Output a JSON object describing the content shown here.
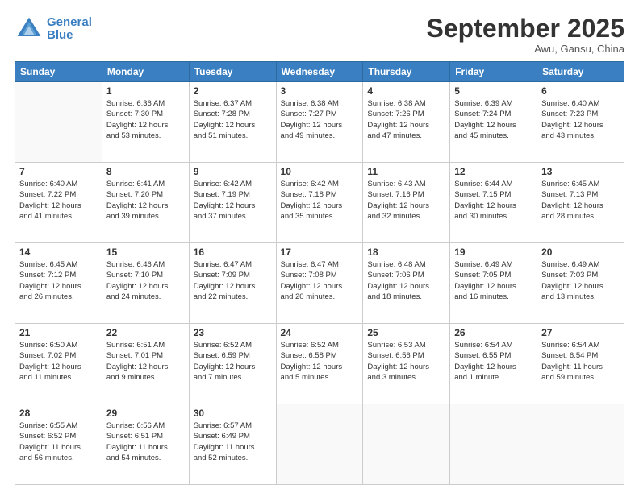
{
  "logo": {
    "line1": "General",
    "line2": "Blue"
  },
  "title": "September 2025",
  "location": "Awu, Gansu, China",
  "days_header": [
    "Sunday",
    "Monday",
    "Tuesday",
    "Wednesday",
    "Thursday",
    "Friday",
    "Saturday"
  ],
  "weeks": [
    [
      {
        "day": "",
        "info": ""
      },
      {
        "day": "1",
        "info": "Sunrise: 6:36 AM\nSunset: 7:30 PM\nDaylight: 12 hours\nand 53 minutes."
      },
      {
        "day": "2",
        "info": "Sunrise: 6:37 AM\nSunset: 7:28 PM\nDaylight: 12 hours\nand 51 minutes."
      },
      {
        "day": "3",
        "info": "Sunrise: 6:38 AM\nSunset: 7:27 PM\nDaylight: 12 hours\nand 49 minutes."
      },
      {
        "day": "4",
        "info": "Sunrise: 6:38 AM\nSunset: 7:26 PM\nDaylight: 12 hours\nand 47 minutes."
      },
      {
        "day": "5",
        "info": "Sunrise: 6:39 AM\nSunset: 7:24 PM\nDaylight: 12 hours\nand 45 minutes."
      },
      {
        "day": "6",
        "info": "Sunrise: 6:40 AM\nSunset: 7:23 PM\nDaylight: 12 hours\nand 43 minutes."
      }
    ],
    [
      {
        "day": "7",
        "info": "Sunrise: 6:40 AM\nSunset: 7:22 PM\nDaylight: 12 hours\nand 41 minutes."
      },
      {
        "day": "8",
        "info": "Sunrise: 6:41 AM\nSunset: 7:20 PM\nDaylight: 12 hours\nand 39 minutes."
      },
      {
        "day": "9",
        "info": "Sunrise: 6:42 AM\nSunset: 7:19 PM\nDaylight: 12 hours\nand 37 minutes."
      },
      {
        "day": "10",
        "info": "Sunrise: 6:42 AM\nSunset: 7:18 PM\nDaylight: 12 hours\nand 35 minutes."
      },
      {
        "day": "11",
        "info": "Sunrise: 6:43 AM\nSunset: 7:16 PM\nDaylight: 12 hours\nand 32 minutes."
      },
      {
        "day": "12",
        "info": "Sunrise: 6:44 AM\nSunset: 7:15 PM\nDaylight: 12 hours\nand 30 minutes."
      },
      {
        "day": "13",
        "info": "Sunrise: 6:45 AM\nSunset: 7:13 PM\nDaylight: 12 hours\nand 28 minutes."
      }
    ],
    [
      {
        "day": "14",
        "info": "Sunrise: 6:45 AM\nSunset: 7:12 PM\nDaylight: 12 hours\nand 26 minutes."
      },
      {
        "day": "15",
        "info": "Sunrise: 6:46 AM\nSunset: 7:10 PM\nDaylight: 12 hours\nand 24 minutes."
      },
      {
        "day": "16",
        "info": "Sunrise: 6:47 AM\nSunset: 7:09 PM\nDaylight: 12 hours\nand 22 minutes."
      },
      {
        "day": "17",
        "info": "Sunrise: 6:47 AM\nSunset: 7:08 PM\nDaylight: 12 hours\nand 20 minutes."
      },
      {
        "day": "18",
        "info": "Sunrise: 6:48 AM\nSunset: 7:06 PM\nDaylight: 12 hours\nand 18 minutes."
      },
      {
        "day": "19",
        "info": "Sunrise: 6:49 AM\nSunset: 7:05 PM\nDaylight: 12 hours\nand 16 minutes."
      },
      {
        "day": "20",
        "info": "Sunrise: 6:49 AM\nSunset: 7:03 PM\nDaylight: 12 hours\nand 13 minutes."
      }
    ],
    [
      {
        "day": "21",
        "info": "Sunrise: 6:50 AM\nSunset: 7:02 PM\nDaylight: 12 hours\nand 11 minutes."
      },
      {
        "day": "22",
        "info": "Sunrise: 6:51 AM\nSunset: 7:01 PM\nDaylight: 12 hours\nand 9 minutes."
      },
      {
        "day": "23",
        "info": "Sunrise: 6:52 AM\nSunset: 6:59 PM\nDaylight: 12 hours\nand 7 minutes."
      },
      {
        "day": "24",
        "info": "Sunrise: 6:52 AM\nSunset: 6:58 PM\nDaylight: 12 hours\nand 5 minutes."
      },
      {
        "day": "25",
        "info": "Sunrise: 6:53 AM\nSunset: 6:56 PM\nDaylight: 12 hours\nand 3 minutes."
      },
      {
        "day": "26",
        "info": "Sunrise: 6:54 AM\nSunset: 6:55 PM\nDaylight: 12 hours\nand 1 minute."
      },
      {
        "day": "27",
        "info": "Sunrise: 6:54 AM\nSunset: 6:54 PM\nDaylight: 11 hours\nand 59 minutes."
      }
    ],
    [
      {
        "day": "28",
        "info": "Sunrise: 6:55 AM\nSunset: 6:52 PM\nDaylight: 11 hours\nand 56 minutes."
      },
      {
        "day": "29",
        "info": "Sunrise: 6:56 AM\nSunset: 6:51 PM\nDaylight: 11 hours\nand 54 minutes."
      },
      {
        "day": "30",
        "info": "Sunrise: 6:57 AM\nSunset: 6:49 PM\nDaylight: 11 hours\nand 52 minutes."
      },
      {
        "day": "",
        "info": ""
      },
      {
        "day": "",
        "info": ""
      },
      {
        "day": "",
        "info": ""
      },
      {
        "day": "",
        "info": ""
      }
    ]
  ]
}
